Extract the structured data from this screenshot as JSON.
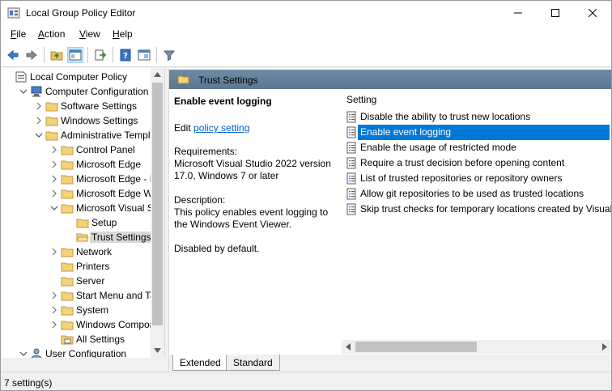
{
  "window": {
    "title": "Local Group Policy Editor"
  },
  "menu": {
    "file": {
      "key": "F",
      "rest": "ile"
    },
    "action": {
      "key": "A",
      "rest": "ction"
    },
    "view": {
      "key": "V",
      "rest": "iew"
    },
    "help": {
      "key": "H",
      "rest": "elp"
    }
  },
  "toolbar": {
    "icons": [
      "back-icon",
      "forward-icon",
      "up-folder-icon",
      "show-hide-tree-icon",
      "export-list-icon",
      "help-icon",
      "extended-view-icon",
      "filter-icon"
    ]
  },
  "tree": {
    "items": [
      {
        "label": "Local Computer Policy",
        "icon": "policy-icon",
        "expander": "none"
      },
      {
        "label": "Computer Configuration",
        "icon": "computer-icon",
        "expander": "expanded"
      },
      {
        "label": "Software Settings",
        "icon": "folder-icon",
        "expander": "collapsed"
      },
      {
        "label": "Windows Settings",
        "icon": "folder-icon",
        "expander": "collapsed"
      },
      {
        "label": "Administrative Templa",
        "icon": "folder-icon",
        "expander": "expanded"
      },
      {
        "label": "Control Panel",
        "icon": "folder-icon",
        "expander": "collapsed"
      },
      {
        "label": "Microsoft Edge",
        "icon": "folder-icon",
        "expander": "collapsed"
      },
      {
        "label": "Microsoft Edge - D",
        "icon": "folder-icon",
        "expander": "collapsed"
      },
      {
        "label": "Microsoft Edge We",
        "icon": "folder-icon",
        "expander": "collapsed"
      },
      {
        "label": "Microsoft Visual St",
        "icon": "folder-icon",
        "expander": "expanded"
      },
      {
        "label": "Setup",
        "icon": "folder-icon",
        "expander": "none"
      },
      {
        "label": "Trust Settings",
        "icon": "folder-open-icon",
        "expander": "none",
        "selected": true
      },
      {
        "label": "Network",
        "icon": "folder-icon",
        "expander": "collapsed"
      },
      {
        "label": "Printers",
        "icon": "folder-icon",
        "expander": "none"
      },
      {
        "label": "Server",
        "icon": "folder-icon",
        "expander": "none"
      },
      {
        "label": "Start Menu and Tas",
        "icon": "folder-icon",
        "expander": "collapsed"
      },
      {
        "label": "System",
        "icon": "folder-icon",
        "expander": "collapsed"
      },
      {
        "label": "Windows Compon",
        "icon": "folder-icon",
        "expander": "collapsed"
      },
      {
        "label": "All Settings",
        "icon": "all-settings-icon",
        "expander": "none"
      },
      {
        "label": "User Configuration",
        "icon": "user-icon",
        "expander": "expanded"
      }
    ]
  },
  "right_header": {
    "title": "Trust Settings"
  },
  "description": {
    "title": "Enable event logging",
    "edit_prefix": "Edit",
    "edit_link": "policy setting",
    "requirements": "Requirements:\nMicrosoft Visual Studio 2022 version 17.0, Windows 7 or later",
    "description": "Description:\nThis policy enables event logging to the Windows Event Viewer.",
    "default": "Disabled by default."
  },
  "settings": {
    "column_header": "Setting",
    "rows": [
      {
        "label": "Disable the ability to trust new locations"
      },
      {
        "label": "Enable event logging",
        "selected": true
      },
      {
        "label": "Enable the usage of restricted mode"
      },
      {
        "label": "Require a trust decision before opening content"
      },
      {
        "label": "List of trusted repositories or repository owners"
      },
      {
        "label": "Allow git repositories to be used as trusted locations"
      },
      {
        "label": "Skip trust checks for temporary locations created by Visual"
      }
    ]
  },
  "tabs": {
    "extended": "Extended",
    "standard": "Standard",
    "active": "Extended"
  },
  "status": {
    "text": "7 setting(s)"
  }
}
